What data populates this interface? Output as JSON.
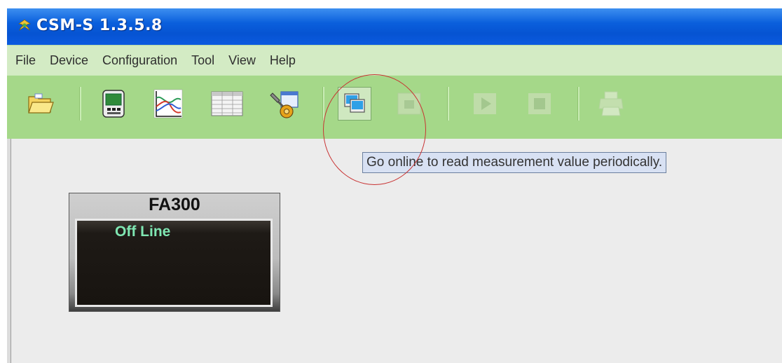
{
  "window": {
    "title": "CSM-S 1.3.5.8"
  },
  "menubar": {
    "items": [
      "File",
      "Device",
      "Configuration",
      "Tool",
      "View",
      "Help"
    ]
  },
  "toolbar": {
    "buttons": [
      {
        "name": "open-folder-icon",
        "enabled": true
      },
      {
        "name": "device-display-icon",
        "enabled": true
      },
      {
        "name": "trend-chart-icon",
        "enabled": true
      },
      {
        "name": "data-table-icon",
        "enabled": true
      },
      {
        "name": "settings-tools-icon",
        "enabled": true
      },
      {
        "name": "go-online-icon",
        "enabled": true
      },
      {
        "name": "go-offline-icon",
        "enabled": false
      },
      {
        "name": "play-icon",
        "enabled": false
      },
      {
        "name": "stop-icon",
        "enabled": false
      },
      {
        "name": "print-icon",
        "enabled": false
      }
    ]
  },
  "tooltip": {
    "text": "Go online to read measurement value periodically."
  },
  "device": {
    "name": "FA300",
    "status": "Off Line"
  },
  "colors": {
    "titlebar": "#0653d2",
    "menubar": "#d3ebc4",
    "toolbar": "#a5d889",
    "status_text": "#7fe6b2",
    "annotation_circle": "#c83232"
  }
}
